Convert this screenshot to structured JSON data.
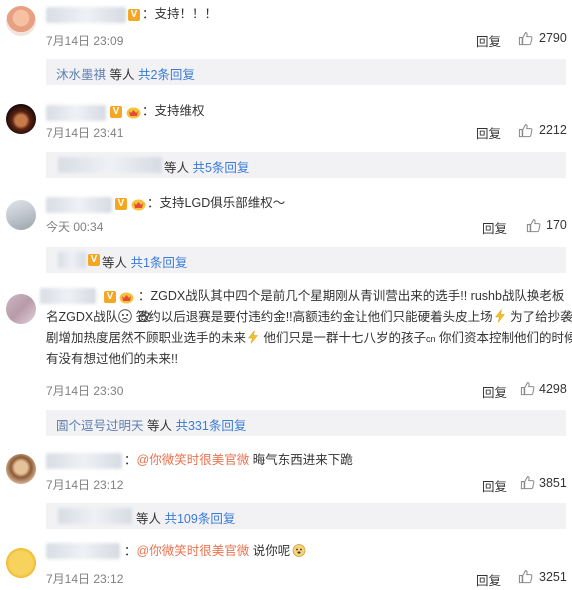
{
  "comments": [
    {
      "text": "支持！！！",
      "time": "7月14日 23:09",
      "reply": "回复",
      "likes": "2790",
      "sub": {
        "name": "沐水墨祺",
        "mid": " 等人 ",
        "count": "共2条回复"
      }
    },
    {
      "text": "支持维权",
      "time": "7月14日 23:41",
      "reply": "回复",
      "likes": "2212",
      "sub": {
        "mid": "等人 ",
        "count": "共5条回复"
      }
    },
    {
      "text": "支持LGD俱乐部维权～",
      "time": "今天 00:34",
      "reply": "回复",
      "likes": "170",
      "sub": {
        "mid": "等人 ",
        "count": "共1条回复"
      }
    },
    {
      "text_line1": "ZGDX战队其中四个是前几个星期刚从青训营出来的选手!! rushb战队换老板改",
      "text_line2a": "名ZGDX战队",
      "text_line2b": " 签约以后退赛是要付违约金!!高额违约金让他们只能硬着头皮上场",
      "text_line2c": " 为了给抄袭",
      "text_line3a": "剧增加热度居然不顾职业选手的未来",
      "text_line3b": " 他们只是一群十七八岁的孩子",
      "text_line3c": "cn",
      "text_line3d": " 你们资本控制他们的时候",
      "text_line4": "有没有想过他们的未来!!",
      "time": "7月14日 23:30",
      "reply": "回复",
      "likes": "4298",
      "sub": {
        "name": "圄个逗号过明天",
        "mid": " 等人 ",
        "count": "共331条回复"
      }
    },
    {
      "mention": "@你微笑时很美官微",
      "text": " 晦气东西进来下跪",
      "time": "7月14日 23:12",
      "reply": "回复",
      "likes": "3851",
      "sub": {
        "mid": "等人 ",
        "count": "共109条回复"
      }
    },
    {
      "mention": "@你微笑时很美官微",
      "text": " 说你呢",
      "time": "7月14日 23:12",
      "reply": "回复",
      "likes": "3251"
    }
  ],
  "icons": {
    "like": "thumbs-up-icon",
    "verified": "v-badge-icon",
    "member": "crown-badge-icon"
  },
  "colors": {
    "link": "#5f7fb0",
    "mention": "#eb7350",
    "badge": "#f5a623",
    "subbox_bg": "#f2f2f5"
  }
}
